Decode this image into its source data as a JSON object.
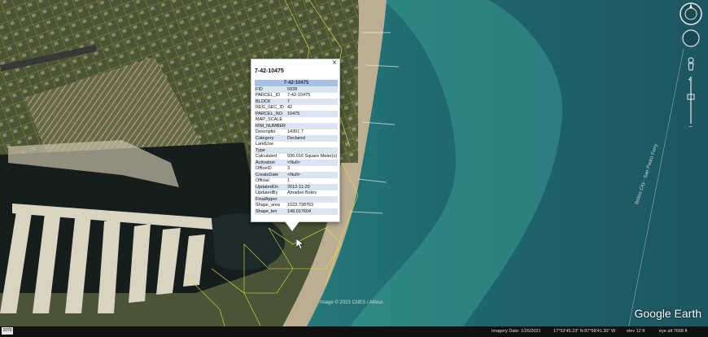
{
  "popup": {
    "title": "7-42-10475",
    "header": "7-42-10475",
    "close_label": "×",
    "rows": [
      {
        "key": "FID",
        "value": "6928"
      },
      {
        "key": "PARCEL_ID",
        "value": "7-42-10475"
      },
      {
        "key": "BLOCK",
        "value": "7"
      },
      {
        "key": "REG_SEC_ID",
        "value": "42"
      },
      {
        "key": "PARCEL_NO",
        "value": "10475"
      },
      {
        "key": "MAP_SCALE",
        "value": ""
      },
      {
        "key": "RIM_NUMBER",
        "value": ""
      },
      {
        "key": "Descriptio",
        "value": "14301 7"
      },
      {
        "key": "Category",
        "value": "Declared"
      },
      {
        "key": "LandUse",
        "value": ""
      },
      {
        "key": "Type",
        "value": ""
      },
      {
        "key": "Calculated",
        "value": "936.016 Square Meter(s)"
      },
      {
        "key": "Activation",
        "value": "<Null>"
      },
      {
        "key": "OfficeID",
        "value": "3"
      },
      {
        "key": "CreateDate",
        "value": "<Null>"
      },
      {
        "key": "Official",
        "value": "1"
      },
      {
        "key": "UpdatedOn",
        "value": "2012-11-29"
      },
      {
        "key": "UpdatedBy",
        "value": "Amadeo Botes"
      },
      {
        "key": "FinalAppro",
        "value": ""
      },
      {
        "key": "Shape_area",
        "value": "1023.798763"
      },
      {
        "key": "Shape_len",
        "value": "148.017604"
      }
    ]
  },
  "map": {
    "watermark": "Google Earth",
    "credits": "Image © 2023 CNES / Airbus",
    "road_label": "Belize City - San Pedro Ferry"
  },
  "status": {
    "scale": "1070",
    "imagery_date": "Imagery Date: 1/26/2021",
    "coordinates": "17°53'45.23\" N   87°58'41.30\" W",
    "elev": "elev     12 ft",
    "eye_alt": "eye alt   7668 ft"
  },
  "colors": {
    "sea_deep": "#1d5560",
    "sea_shallow": "#2f8f8a",
    "sand": "#b9a58a",
    "land": "#4f5a38",
    "lagoon": "#141c1c",
    "parcel_line": "#e6e23a",
    "popup_header": "#a8c2e2",
    "popup_row_alt": "#dbe5f1"
  }
}
